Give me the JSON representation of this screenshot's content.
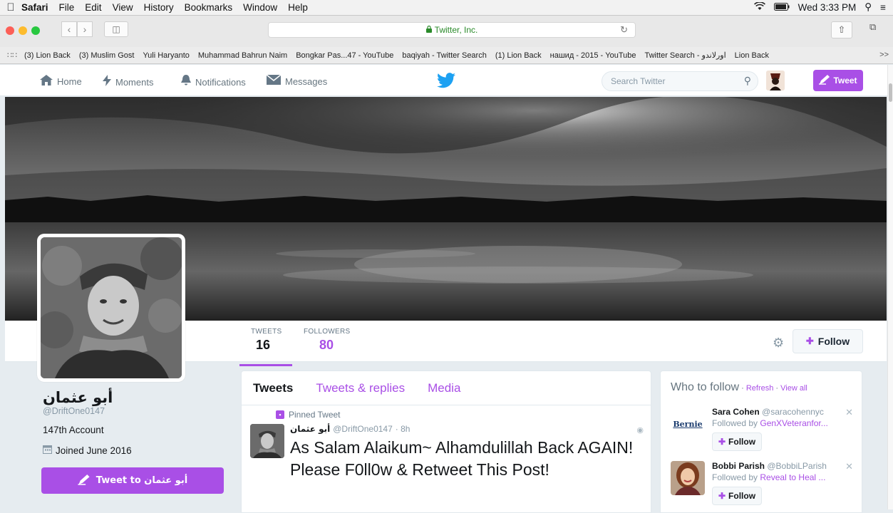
{
  "menubar": {
    "apple": "",
    "items": [
      "Safari",
      "File",
      "Edit",
      "View",
      "History",
      "Bookmarks",
      "Window",
      "Help"
    ],
    "clock": "Wed 3:33 PM"
  },
  "browser": {
    "url_text": "Twitter, Inc.",
    "bookmarks": [
      "(3) Lion Back",
      "(3) Muslim Gost",
      "Yuli Haryanto",
      "Muhammad Bahrun Naim",
      "Bongkar Pas...47 - YouTube",
      "baqiyah - Twitter Search",
      "(1) Lion Back",
      "нашид - 2015 - YouTube",
      "Twitter Search - اورلاندو",
      "Lion Back"
    ],
    "more": ">>"
  },
  "twitter_nav": {
    "home": "Home",
    "moments": "Moments",
    "notifications": "Notifications",
    "messages": "Messages",
    "search_placeholder": "Search Twitter",
    "tweet_button": "Tweet"
  },
  "stats": {
    "tweets_label": "TWEETS",
    "tweets_value": "16",
    "followers_label": "FOLLOWERS",
    "followers_value": "80",
    "follow_button": "Follow"
  },
  "profile": {
    "name": "أبو عثمان",
    "handle": "@DriftOne0147",
    "bio": "147th Account",
    "joined": "Joined June 2016",
    "tweet_to": "Tweet to أبو عثمان"
  },
  "timeline": {
    "tabs": [
      "Tweets",
      "Tweets & replies",
      "Media"
    ],
    "pinned_label": "Pinned Tweet",
    "tweet": {
      "name": "أبو عثمان",
      "handle": "@DriftOne0147",
      "time": "· 8h",
      "text": "As Salam Alaikum~ Alhamdulillah Back AGAIN! Please F0ll0w & Retweet This Post!"
    }
  },
  "who_to_follow": {
    "title": "Who to follow",
    "dot1": " · ",
    "refresh": "Refresh",
    "dot2": " · ",
    "view_all": "View all",
    "suggestions": [
      {
        "name": "Sara Cohen",
        "handle": "@saracohennyc",
        "followed_by_prefix": "Followed by ",
        "followed_by": "GenXVeteranfor...",
        "follow": "Follow",
        "avatar_text": "Bernie"
      },
      {
        "name": "Bobbi Parish",
        "handle": "@BobbiLParish",
        "followed_by_prefix": "Followed by ",
        "followed_by": "Reveal to Heal ...",
        "follow": "Follow"
      }
    ]
  },
  "colors": {
    "accent": "#a94fe6",
    "twitter_blue": "#1da1f2",
    "background": "#e6ecf0"
  }
}
